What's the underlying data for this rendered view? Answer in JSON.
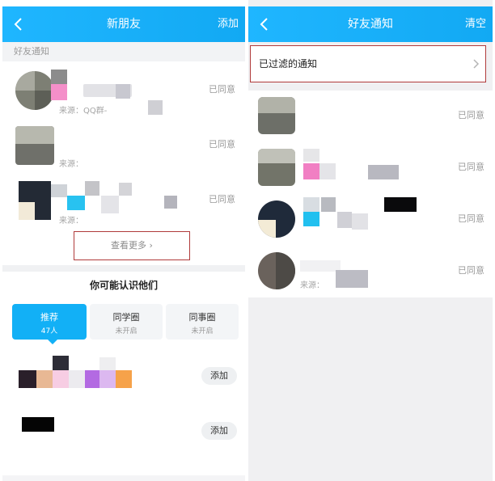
{
  "left": {
    "header": {
      "title": "新朋友",
      "action": "添加"
    },
    "section_label": "好友通知",
    "notifications": [
      {
        "source": "来源：QQ群-",
        "status": "已同意"
      },
      {
        "source": "来源：",
        "status": "已同意"
      },
      {
        "source": "来源：",
        "status": "已同意"
      }
    ],
    "see_more": "查看更多 ›",
    "pymk_title": "你可能认识他们",
    "tabs": [
      {
        "label": "推荐",
        "sub": "47人"
      },
      {
        "label": "同学圈",
        "sub": "未开启"
      },
      {
        "label": "同事圈",
        "sub": "未开启"
      }
    ],
    "suggestions": [
      {
        "add_label": "添加"
      },
      {
        "add_label": "添加"
      }
    ]
  },
  "right": {
    "header": {
      "title": "好友通知",
      "action": "清空"
    },
    "filtered_label": "已过滤的通知",
    "notifications": [
      {
        "status": "已同意",
        "source": ""
      },
      {
        "status": "已同意",
        "source": ""
      },
      {
        "status": "已同意",
        "source": ""
      },
      {
        "status": "已同意",
        "source": "来源："
      }
    ]
  },
  "colors": {
    "header_start": "#1fb6ff",
    "header_end": "#12a9f3",
    "highlight_border": "#b03a3a",
    "tab_active": "#12b0f6"
  }
}
